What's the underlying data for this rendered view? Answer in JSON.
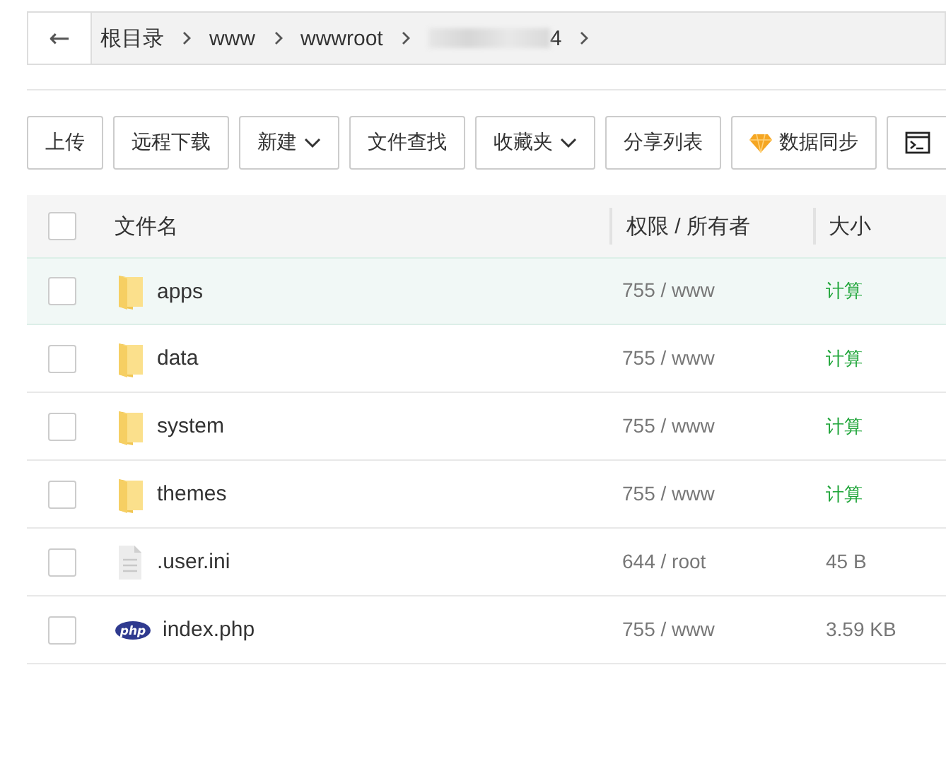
{
  "breadcrumb": {
    "back_button": "←",
    "items": [
      {
        "label": "根目录",
        "redacted": false
      },
      {
        "label": "www",
        "redacted": false
      },
      {
        "label": "wwwroot",
        "redacted": false
      },
      {
        "label": "4",
        "redacted": true
      }
    ]
  },
  "toolbar": [
    {
      "label": "上传",
      "kind": "plain"
    },
    {
      "label": "远程下载",
      "kind": "plain"
    },
    {
      "label": "新建",
      "kind": "dropdown"
    },
    {
      "label": "文件查找",
      "kind": "plain"
    },
    {
      "label": "收藏夹",
      "kind": "dropdown"
    },
    {
      "label": "分享列表",
      "kind": "plain"
    },
    {
      "label": "数据同步",
      "kind": "gem"
    },
    {
      "kind": "terminal"
    }
  ],
  "table": {
    "all_checked": false,
    "columns": [
      "文件名",
      "权限 / 所有者",
      "大小"
    ],
    "rows": [
      {
        "name": "apps",
        "kind": "folder",
        "checked": false,
        "highlighted": true,
        "permissions": "755 / www",
        "size": "计算"
      },
      {
        "name": "data",
        "kind": "folder",
        "checked": false,
        "highlighted": false,
        "permissions": "755 / www",
        "size": "计算"
      },
      {
        "name": "system",
        "kind": "folder",
        "checked": false,
        "highlighted": false,
        "permissions": "755 / www",
        "size": "计算"
      },
      {
        "name": "themes",
        "kind": "folder",
        "checked": false,
        "highlighted": false,
        "permissions": "755 / www",
        "size": "计算"
      },
      {
        "name": ".user.ini",
        "kind": "file",
        "checked": false,
        "highlighted": false,
        "permissions": "644 / root",
        "size": "45 B"
      },
      {
        "name": "index.php",
        "kind": "php",
        "icon_label": "php",
        "checked": false,
        "highlighted": false,
        "permissions": "755 / www",
        "size": "3.59 KB"
      }
    ]
  }
}
